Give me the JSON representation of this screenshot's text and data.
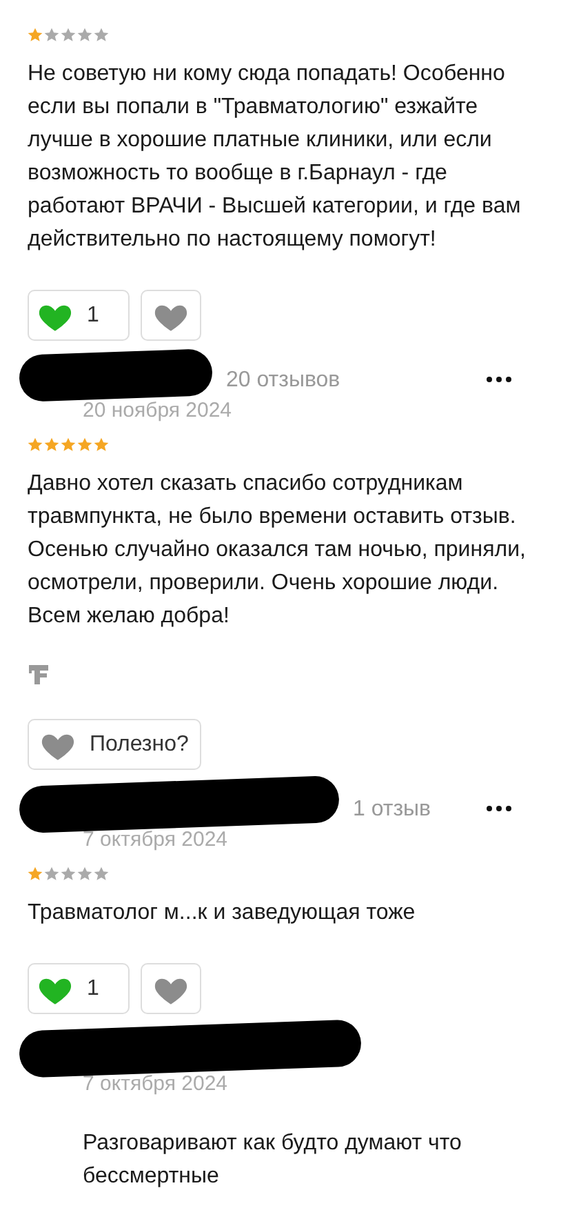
{
  "reviews": [
    {
      "kind": "review",
      "redacted": false,
      "has_menu": false,
      "stars": 1,
      "text": "Не советую ни кому сюда попадать! Особенно если вы попали в \"Травматологию\" езжайте лучше в хорошие платные клиники, или если возможность то вообще в г.Барнаул - где работают ВРАЧИ - Высшей категории, и где вам действительно по настоящему помогут!",
      "source_logo": false,
      "reactions": [
        {
          "kind": "like",
          "count": "1",
          "selected": true
        },
        {
          "kind": "dislike",
          "selected": false
        }
      ]
    },
    {
      "kind": "review",
      "redacted": true,
      "has_menu": true,
      "review_count": "20 отзывов",
      "date": "20 ноября 2024",
      "stars": 5,
      "text": "Давно хотел сказать спасибо сотрудникам травмпункта, не было времени оставить отзыв. Осенью случайно оказался там ночью, приняли, осмотрели, проверили. Очень хорошие люди. Всем желаю добра!",
      "source_logo": true,
      "reactions": [
        {
          "kind": "helpful",
          "label": "Полезно?"
        }
      ]
    },
    {
      "kind": "review",
      "redacted": true,
      "has_menu": true,
      "review_count": "1 отзыв",
      "date": "7 октября 2024",
      "stars": 1,
      "text": "Травматолог м...к и заведующая тоже",
      "source_logo": false,
      "reactions": [
        {
          "kind": "like",
          "count": "1",
          "selected": true
        },
        {
          "kind": "dislike",
          "selected": false
        }
      ]
    },
    {
      "kind": "reply",
      "redacted": true,
      "has_menu": false,
      "date": "7 октября 2024",
      "text": "Разговаривают как будто думают что бессмертные"
    }
  ]
}
